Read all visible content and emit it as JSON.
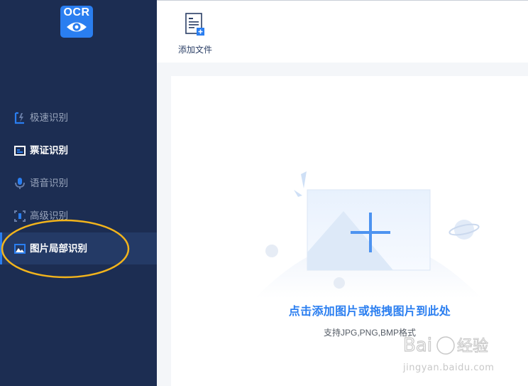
{
  "logo": {
    "text": "OCR"
  },
  "sidebar": {
    "items": [
      {
        "label": "极速识别"
      },
      {
        "label": "票证识别"
      },
      {
        "label": "语音识别"
      },
      {
        "label": "高级识别"
      },
      {
        "label": "图片局部识别"
      }
    ],
    "active_index": 4
  },
  "toolbar": {
    "add_file_label": "添加文件"
  },
  "dropzone": {
    "title": "点击添加图片或拖拽图片到此处",
    "hint": "支持JPG,PNG,BMP格式"
  },
  "watermark": {
    "brand": "Bai 经验",
    "url": "jingyan.baidu.com"
  },
  "colors": {
    "sidebar_bg": "#1c2d52",
    "accent": "#2a7ef0",
    "annotation": "#f2b41c"
  }
}
